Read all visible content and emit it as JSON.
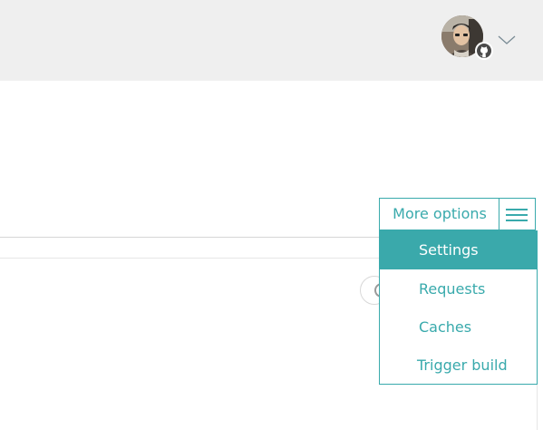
{
  "header": {
    "avatar_icon": "user-avatar",
    "badge_icon": "github-icon",
    "dropdown_icon": "chevron-down-icon"
  },
  "options": {
    "toggle_label": "More options",
    "toggle_icon": "hamburger-menu-icon",
    "items": [
      {
        "label": "Settings",
        "active": true
      },
      {
        "label": "Requests",
        "active": false
      },
      {
        "label": "Caches",
        "active": false
      },
      {
        "label": "Trigger build",
        "active": false
      }
    ]
  },
  "colors": {
    "accent": "#39aaac",
    "header_bg": "#efefef",
    "active_bg": "#3aa9ab",
    "active_text": "#ffffff"
  }
}
